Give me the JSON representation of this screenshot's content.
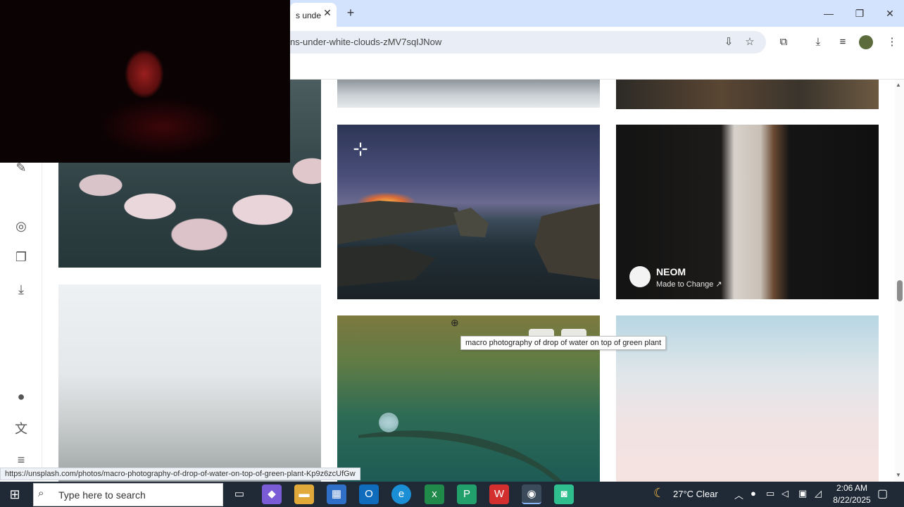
{
  "browser": {
    "tab_title": "s unde",
    "tab_close": "✕",
    "new_tab": "+",
    "url_fragment": "ns-under-white-clouds-zMV7sqIJNow",
    "window_controls": {
      "minimize": "—",
      "maximize": "❐",
      "close": "✕"
    }
  },
  "page": {
    "sponsor": {
      "name": "NEOM",
      "tagline": "Made to Change ↗"
    },
    "tooltip": "macro photography of drop of water on top of green plant",
    "status_link": "https://unsplash.com/photos/macro-photography-of-drop-of-water-on-top-of-green-plant-Kp9z6zcUfGw"
  },
  "taskbar": {
    "search_placeholder": "Type here to search",
    "weather": "27°C  Clear",
    "time": "2:06 AM",
    "date": "8/22/2025"
  },
  "colors": {
    "tabbar": "#d3e3fd",
    "taskbar": "#1f2a36"
  },
  "icons": [
    "install-icon",
    "star-icon",
    "extensions-icon",
    "download-icon",
    "media-icon",
    "profile-icon",
    "menu-icon",
    "compass-icon",
    "collections-icon",
    "rail-download-icon",
    "user-icon",
    "translate-icon",
    "hamburger-icon",
    "pen-icon",
    "windows-start-icon",
    "search-icon",
    "task-view-icon",
    "copilot-icon",
    "file-explorer-icon",
    "store-icon",
    "outlook-icon",
    "edge-icon",
    "excel-icon",
    "app-icon",
    "wps-icon",
    "chrome-icon",
    "android-icon",
    "moon-icon"
  ]
}
